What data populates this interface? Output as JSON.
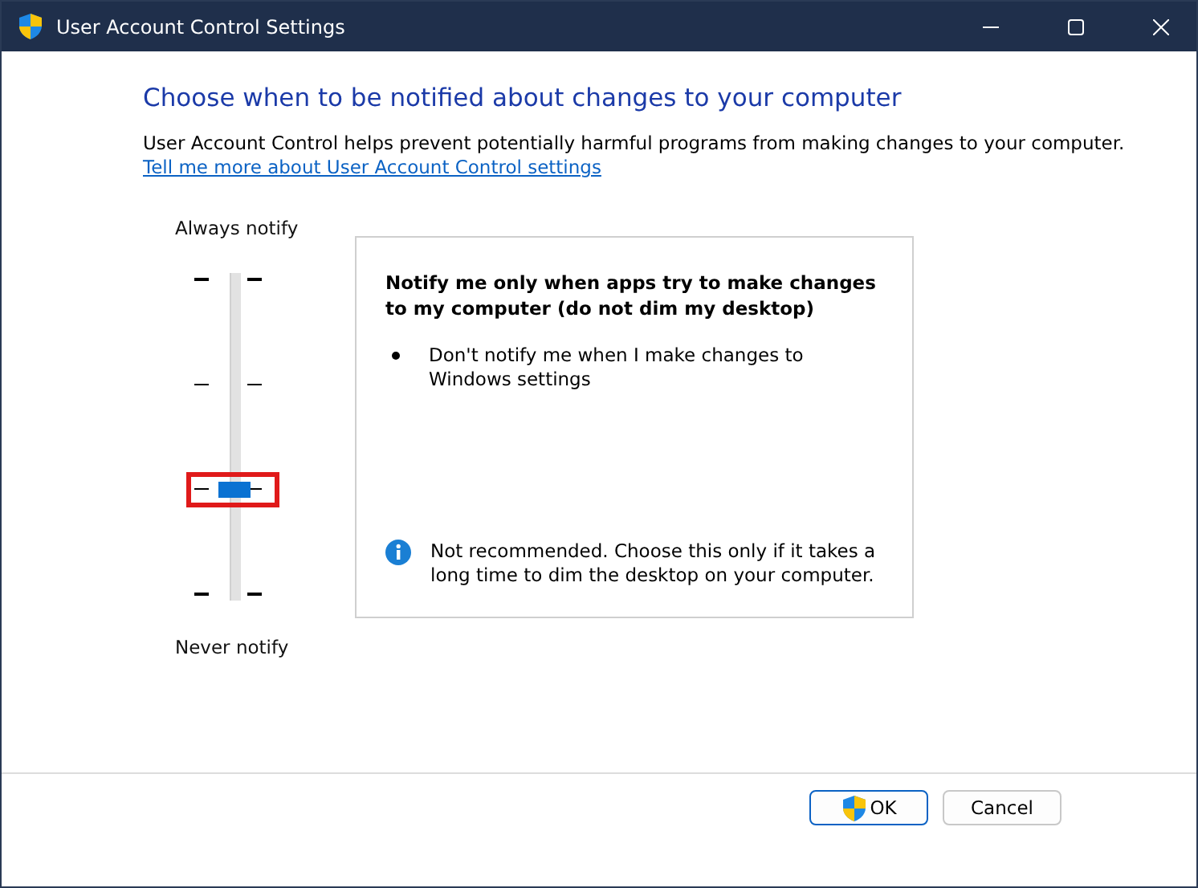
{
  "window": {
    "title": "User Account Control Settings"
  },
  "heading": "Choose when to be notified about changes to your computer",
  "description": "User Account Control helps prevent potentially harmful programs from making changes to your computer.",
  "link": "Tell me more about User Account Control settings",
  "slider": {
    "top_label": "Always notify",
    "bottom_label": "Never notify",
    "level": 0.333,
    "highlighted": true
  },
  "panel": {
    "title": "Notify me only when apps try to make changes to my computer (do not dim my desktop)",
    "bullets": [
      "Don't notify me when I make changes to Windows settings"
    ],
    "note": "Not recommended. Choose this only if it takes a long time to dim the desktop on your computer."
  },
  "buttons": [
    {
      "label": "OK",
      "kind": "shield"
    },
    {
      "label": "Cancel",
      "kind": "plain"
    }
  ]
}
